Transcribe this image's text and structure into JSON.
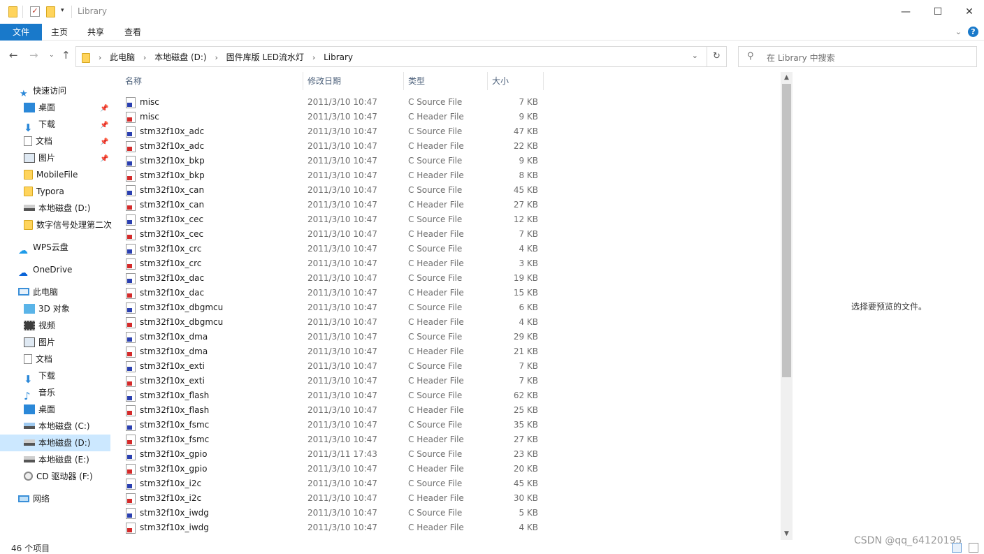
{
  "window": {
    "title": "Library",
    "minimize": "—",
    "maximize": "☐",
    "close": "✕"
  },
  "ribbon": {
    "tabs": [
      "文件",
      "主页",
      "共享",
      "查看"
    ],
    "help": "?"
  },
  "nav": {
    "breadcrumb": [
      "此电脑",
      "本地磁盘 (D:)",
      "固件库版 LED流水灯",
      "Library"
    ],
    "search_placeholder": "在 Library 中搜索"
  },
  "sidebar": {
    "quick_access": "快速访问",
    "pinned": [
      "桌面",
      "下载",
      "文档",
      "图片"
    ],
    "folders": [
      "MobileFile",
      "Typora",
      "本地磁盘 (D:)",
      "数字信号处理第二次"
    ],
    "wps": "WPS云盘",
    "onedrive": "OneDrive",
    "this_pc": "此电脑",
    "pc_items": [
      "3D 对象",
      "视频",
      "图片",
      "文档",
      "下载",
      "音乐",
      "桌面",
      "本地磁盘 (C:)",
      "本地磁盘 (D:)",
      "本地磁盘 (E:)",
      "CD 驱动器 (F:)"
    ],
    "network": "网络"
  },
  "columns": {
    "name": "名称",
    "date": "修改日期",
    "type": "类型",
    "size": "大小"
  },
  "files": [
    {
      "name": "misc",
      "date": "2011/3/10 10:47",
      "type": "C Source File",
      "size": "7 KB",
      "kind": "src"
    },
    {
      "name": "misc",
      "date": "2011/3/10 10:47",
      "type": "C Header File",
      "size": "9 KB",
      "kind": "hdr"
    },
    {
      "name": "stm32f10x_adc",
      "date": "2011/3/10 10:47",
      "type": "C Source File",
      "size": "47 KB",
      "kind": "src"
    },
    {
      "name": "stm32f10x_adc",
      "date": "2011/3/10 10:47",
      "type": "C Header File",
      "size": "22 KB",
      "kind": "hdr"
    },
    {
      "name": "stm32f10x_bkp",
      "date": "2011/3/10 10:47",
      "type": "C Source File",
      "size": "9 KB",
      "kind": "src"
    },
    {
      "name": "stm32f10x_bkp",
      "date": "2011/3/10 10:47",
      "type": "C Header File",
      "size": "8 KB",
      "kind": "hdr"
    },
    {
      "name": "stm32f10x_can",
      "date": "2011/3/10 10:47",
      "type": "C Source File",
      "size": "45 KB",
      "kind": "src"
    },
    {
      "name": "stm32f10x_can",
      "date": "2011/3/10 10:47",
      "type": "C Header File",
      "size": "27 KB",
      "kind": "hdr"
    },
    {
      "name": "stm32f10x_cec",
      "date": "2011/3/10 10:47",
      "type": "C Source File",
      "size": "12 KB",
      "kind": "src"
    },
    {
      "name": "stm32f10x_cec",
      "date": "2011/3/10 10:47",
      "type": "C Header File",
      "size": "7 KB",
      "kind": "hdr"
    },
    {
      "name": "stm32f10x_crc",
      "date": "2011/3/10 10:47",
      "type": "C Source File",
      "size": "4 KB",
      "kind": "src"
    },
    {
      "name": "stm32f10x_crc",
      "date": "2011/3/10 10:47",
      "type": "C Header File",
      "size": "3 KB",
      "kind": "hdr"
    },
    {
      "name": "stm32f10x_dac",
      "date": "2011/3/10 10:47",
      "type": "C Source File",
      "size": "19 KB",
      "kind": "src"
    },
    {
      "name": "stm32f10x_dac",
      "date": "2011/3/10 10:47",
      "type": "C Header File",
      "size": "15 KB",
      "kind": "hdr"
    },
    {
      "name": "stm32f10x_dbgmcu",
      "date": "2011/3/10 10:47",
      "type": "C Source File",
      "size": "6 KB",
      "kind": "src"
    },
    {
      "name": "stm32f10x_dbgmcu",
      "date": "2011/3/10 10:47",
      "type": "C Header File",
      "size": "4 KB",
      "kind": "hdr"
    },
    {
      "name": "stm32f10x_dma",
      "date": "2011/3/10 10:47",
      "type": "C Source File",
      "size": "29 KB",
      "kind": "src"
    },
    {
      "name": "stm32f10x_dma",
      "date": "2011/3/10 10:47",
      "type": "C Header File",
      "size": "21 KB",
      "kind": "hdr"
    },
    {
      "name": "stm32f10x_exti",
      "date": "2011/3/10 10:47",
      "type": "C Source File",
      "size": "7 KB",
      "kind": "src"
    },
    {
      "name": "stm32f10x_exti",
      "date": "2011/3/10 10:47",
      "type": "C Header File",
      "size": "7 KB",
      "kind": "hdr"
    },
    {
      "name": "stm32f10x_flash",
      "date": "2011/3/10 10:47",
      "type": "C Source File",
      "size": "62 KB",
      "kind": "src"
    },
    {
      "name": "stm32f10x_flash",
      "date": "2011/3/10 10:47",
      "type": "C Header File",
      "size": "25 KB",
      "kind": "hdr"
    },
    {
      "name": "stm32f10x_fsmc",
      "date": "2011/3/10 10:47",
      "type": "C Source File",
      "size": "35 KB",
      "kind": "src"
    },
    {
      "name": "stm32f10x_fsmc",
      "date": "2011/3/10 10:47",
      "type": "C Header File",
      "size": "27 KB",
      "kind": "hdr"
    },
    {
      "name": "stm32f10x_gpio",
      "date": "2011/3/11 17:43",
      "type": "C Source File",
      "size": "23 KB",
      "kind": "src"
    },
    {
      "name": "stm32f10x_gpio",
      "date": "2011/3/10 10:47",
      "type": "C Header File",
      "size": "20 KB",
      "kind": "hdr"
    },
    {
      "name": "stm32f10x_i2c",
      "date": "2011/3/10 10:47",
      "type": "C Source File",
      "size": "45 KB",
      "kind": "src"
    },
    {
      "name": "stm32f10x_i2c",
      "date": "2011/3/10 10:47",
      "type": "C Header File",
      "size": "30 KB",
      "kind": "hdr"
    },
    {
      "name": "stm32f10x_iwdg",
      "date": "2011/3/10 10:47",
      "type": "C Source File",
      "size": "5 KB",
      "kind": "src"
    },
    {
      "name": "stm32f10x_iwdg",
      "date": "2011/3/10 10:47",
      "type": "C Header File",
      "size": "4 KB",
      "kind": "hdr"
    }
  ],
  "preview": {
    "message": "选择要预览的文件。"
  },
  "status": {
    "count": "46 个项目"
  },
  "watermark": "CSDN @qq_64120195",
  "colors": {
    "accent": "#1979ca",
    "selected": "#cce8ff",
    "source_icon": "#2a3fb0",
    "header_icon": "#d42a2a"
  }
}
